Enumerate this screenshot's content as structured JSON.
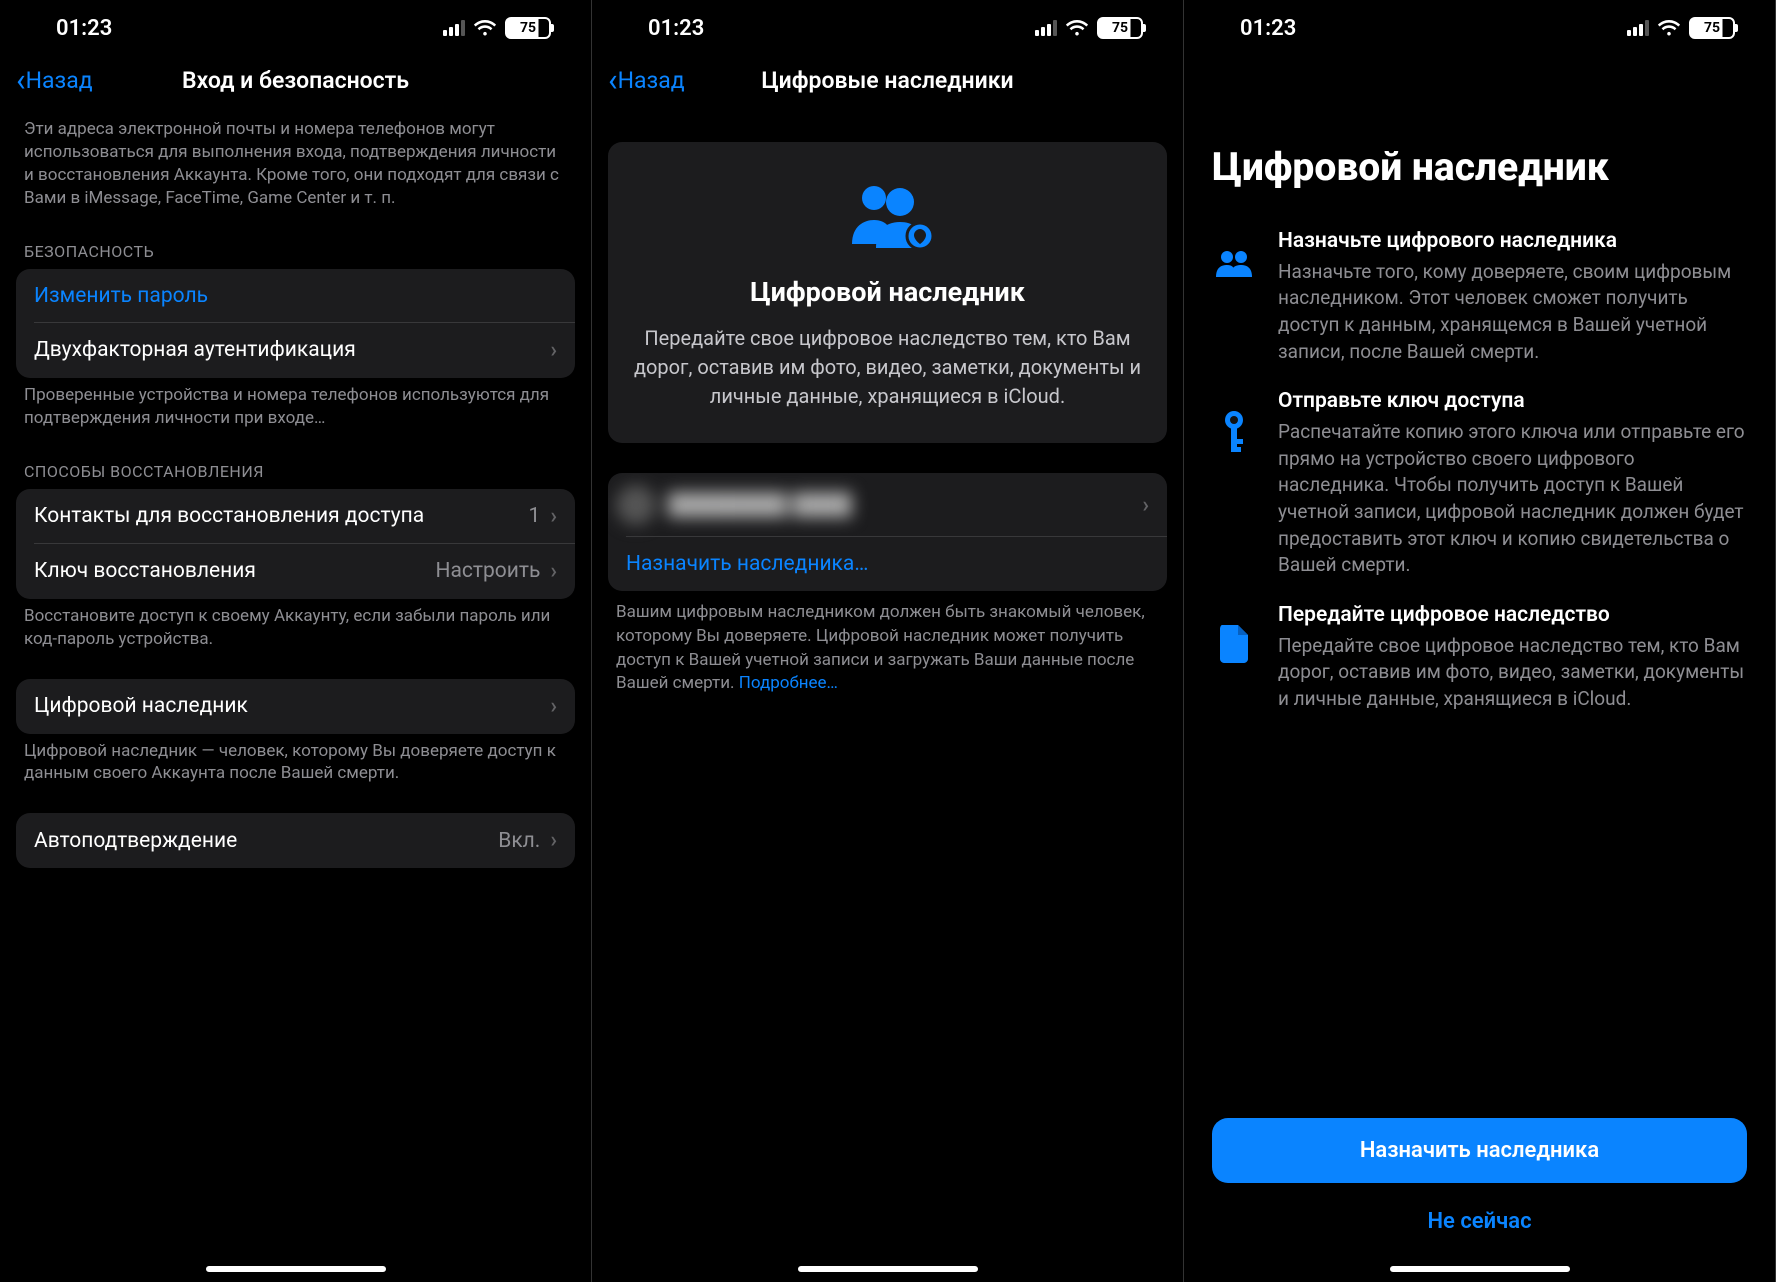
{
  "status": {
    "time": "01:23",
    "battery": "75"
  },
  "p1": {
    "back": "Назад",
    "title": "Вход и безопасность",
    "intro_footer": "Эти адреса электронной почты и номера телефонов могут использоваться для выполнения входа, подтверждения личности и восстановления Аккаунта. Кроме того, они подходят для связи с Вами в iMessage, FaceTime, Game Center и т. п.",
    "sec_header": "БЕЗОПАСНОСТЬ",
    "change_password": "Изменить пароль",
    "two_factor": "Двухфакторная аутентификация",
    "sec_footer": "Проверенные устройства и номера телефонов используются для подтверждения личности при входе…",
    "recovery_header": "СПОСОБЫ ВОССТАНОВЛЕНИЯ",
    "recovery_contacts": "Контакты для восстановления доступа",
    "recovery_contacts_count": "1",
    "recovery_key": "Ключ восстановления",
    "recovery_key_value": "Настроить",
    "recovery_footer": "Восстановите доступ к своему Аккаунту, если забыли пароль или код-пароль устройства.",
    "legacy": "Цифровой наследник",
    "legacy_footer": "Цифровой наследник — человек, которому Вы доверяете доступ к данным своего Аккаунта после Вашей смерти.",
    "auto_verify": "Автоподтверждение",
    "auto_verify_value": "Вкл."
  },
  "p2": {
    "back": "Назад",
    "title": "Цифровые наследники",
    "hero_title": "Цифровой наследник",
    "hero_desc": "Передайте свое цифровое наследство тем, кто Вам дорог, оставив им фото, видео, заметки, документы и личные данные, хранящиеся в iCloud.",
    "assign": "Назначить наследника…",
    "footer": "Вашим цифровым наследником должен быть знакомый человек, которому Вы доверяете. Цифровой наследник может получить доступ к Вашей учетной записи и загружать Ваши данные после Вашей смерти.",
    "learn_more": "Подробнее…"
  },
  "p3": {
    "title": "Цифровой наследник",
    "f1_title": "Назначьте цифрового наследника",
    "f1_desc": "Назначьте того, кому доверяете, своим цифровым наследником. Этот человек сможет получить доступ к данным, хранящемся в Вашей учетной записи, после Вашей смерти.",
    "f2_title": "Отправьте ключ доступа",
    "f2_desc": "Распечатайте копию этого ключа или отправьте его прямо на устройство своего цифрового наследника. Чтобы получить доступ к Вашей учетной записи, цифровой наследник должен будет предоставить этот ключ и копию свидетельства о Вашей смерти.",
    "f3_title": "Передайте цифровое наследство",
    "f3_desc": "Передайте свое цифровое наследство тем, кто Вам дорог, оставив им фото, видео, заметки, документы и личные данные, хранящиеся в iCloud.",
    "primary": "Назначить наследника",
    "secondary": "Не сейчас"
  }
}
